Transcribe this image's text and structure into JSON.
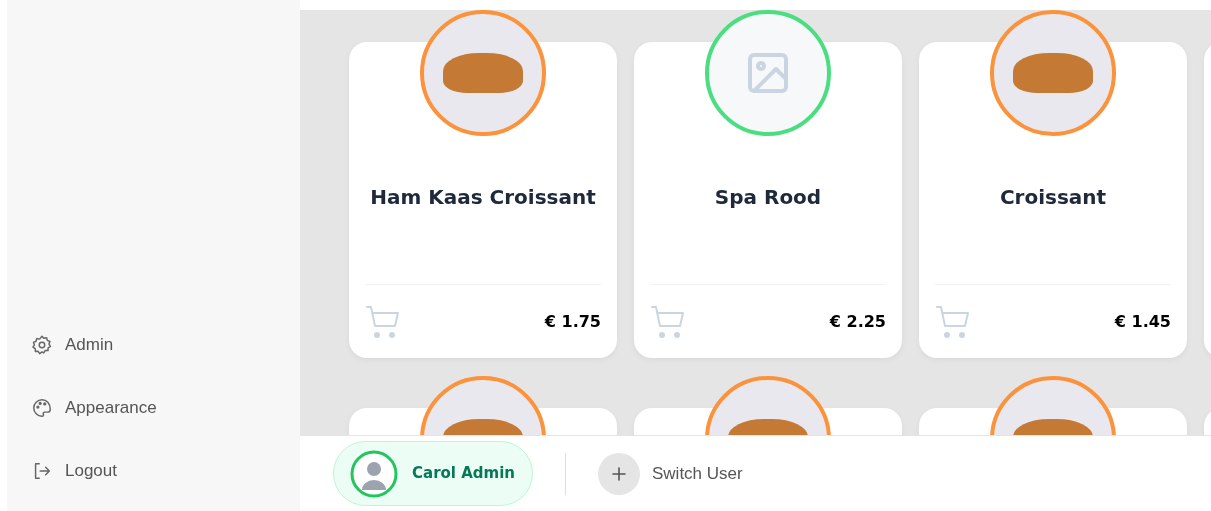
{
  "sidebar": {
    "items": [
      {
        "label": "Admin",
        "kind": "gear"
      },
      {
        "label": "Appearance",
        "kind": "palette"
      },
      {
        "label": "Logout",
        "kind": "logout"
      }
    ]
  },
  "products": [
    {
      "name": "Ham Kaas Croissant",
      "price": "€ 1.75",
      "kind": "photo",
      "color": "#fb923c"
    },
    {
      "name": "Spa Rood",
      "price": "€ 2.25",
      "kind": "no-image",
      "color": "#4ade80"
    },
    {
      "name": "Croissant",
      "price": "€ 1.45",
      "kind": "photo",
      "color": "#fb923c"
    },
    {
      "kind": "partial"
    },
    {
      "kind": "photo",
      "color": "#fb923c"
    },
    {
      "kind": "photo",
      "color": "#fb923c"
    },
    {
      "kind": "photo",
      "color": "#fb923c"
    },
    {
      "kind": "partial"
    }
  ],
  "user_bar": {
    "current_user": {
      "name": "Carol Admin",
      "selected": true
    },
    "switch_label": "Switch User"
  }
}
